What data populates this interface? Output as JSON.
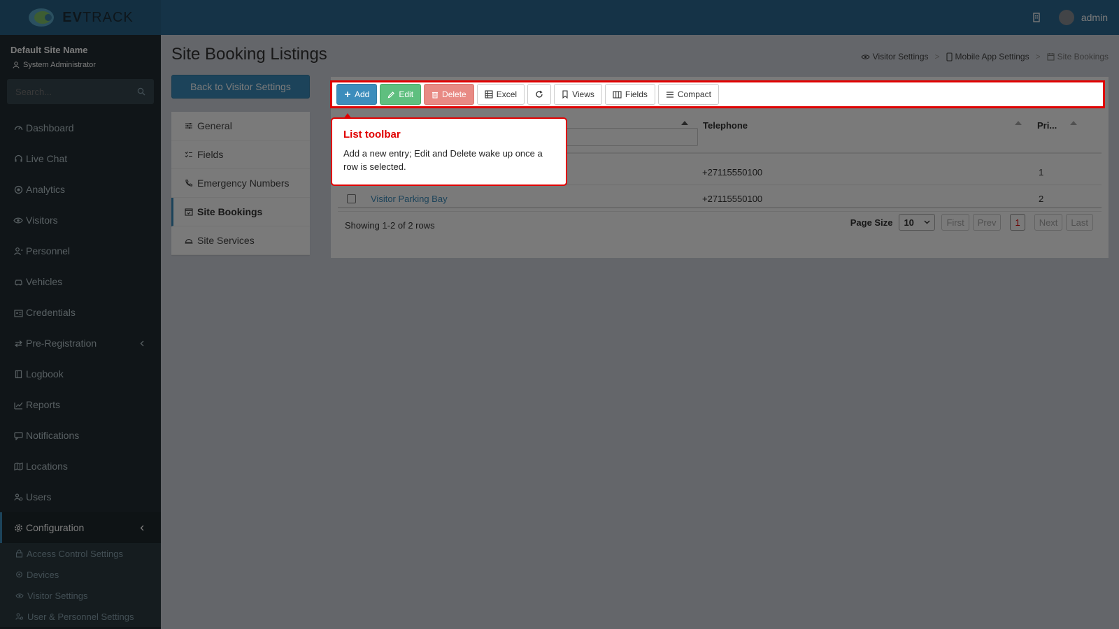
{
  "header": {
    "logo_text_bold": "EV",
    "logo_text_light": "TRACK",
    "username": "admin"
  },
  "sidebar": {
    "site_name": "Default Site Name",
    "role": "System Administrator",
    "search_placeholder": "Search...",
    "items": [
      {
        "label": "Dashboard",
        "icon": "dashboard-icon"
      },
      {
        "label": "Live Chat",
        "icon": "headset-icon"
      },
      {
        "label": "Analytics",
        "icon": "target-icon"
      },
      {
        "label": "Visitors",
        "icon": "eye-icon"
      },
      {
        "label": "Personnel",
        "icon": "person-icon"
      },
      {
        "label": "Vehicles",
        "icon": "car-icon"
      },
      {
        "label": "Credentials",
        "icon": "id-card-icon"
      },
      {
        "label": "Pre-Registration",
        "icon": "arrows-icon"
      },
      {
        "label": "Logbook",
        "icon": "book-icon"
      },
      {
        "label": "Reports",
        "icon": "chart-icon"
      },
      {
        "label": "Notifications",
        "icon": "chat-icon"
      },
      {
        "label": "Locations",
        "icon": "map-icon"
      },
      {
        "label": "Users",
        "icon": "users-icon"
      },
      {
        "label": "Configuration",
        "icon": "gear-icon"
      }
    ],
    "sub_items": [
      {
        "label": "Access Control Settings",
        "icon": "lock-icon"
      },
      {
        "label": "Devices",
        "icon": "device-icon"
      },
      {
        "label": "Visitor Settings",
        "icon": "eye-icon"
      },
      {
        "label": "User & Personnel Settings",
        "icon": "users-icon"
      }
    ]
  },
  "page": {
    "title": "Site Booking Listings",
    "breadcrumb": [
      "Visitor Settings",
      "Mobile App Settings",
      "Site Bookings"
    ],
    "back_button": "Back to Visitor Settings"
  },
  "settings_menu": [
    {
      "label": "General",
      "icon": "sliders-icon"
    },
    {
      "label": "Fields",
      "icon": "checklist-icon"
    },
    {
      "label": "Emergency Numbers",
      "icon": "phone-icon"
    },
    {
      "label": "Site Bookings",
      "icon": "calendar-icon"
    },
    {
      "label": "Site Services",
      "icon": "cloche-icon"
    }
  ],
  "toolbar": {
    "add": "Add",
    "edit": "Edit",
    "delete": "Delete",
    "excel": "Excel",
    "views": "Views",
    "fields": "Fields",
    "compact": "Compact"
  },
  "grid": {
    "columns": [
      "Telephone",
      "Pri..."
    ],
    "rows": [
      {
        "name": "",
        "telephone": "+27115550100",
        "priority": "1"
      },
      {
        "name": "Visitor Parking Bay",
        "telephone": "+27115550100",
        "priority": "2"
      }
    ],
    "showing": "Showing 1-2 of 2 rows",
    "page_size_label": "Page Size",
    "page_size": "10",
    "first": "First",
    "prev": "Prev",
    "current_page": "1",
    "next": "Next",
    "last": "Last"
  },
  "tooltip": {
    "title": "List toolbar",
    "body": "Add a new entry; Edit and Delete wake up once a row is selected."
  }
}
